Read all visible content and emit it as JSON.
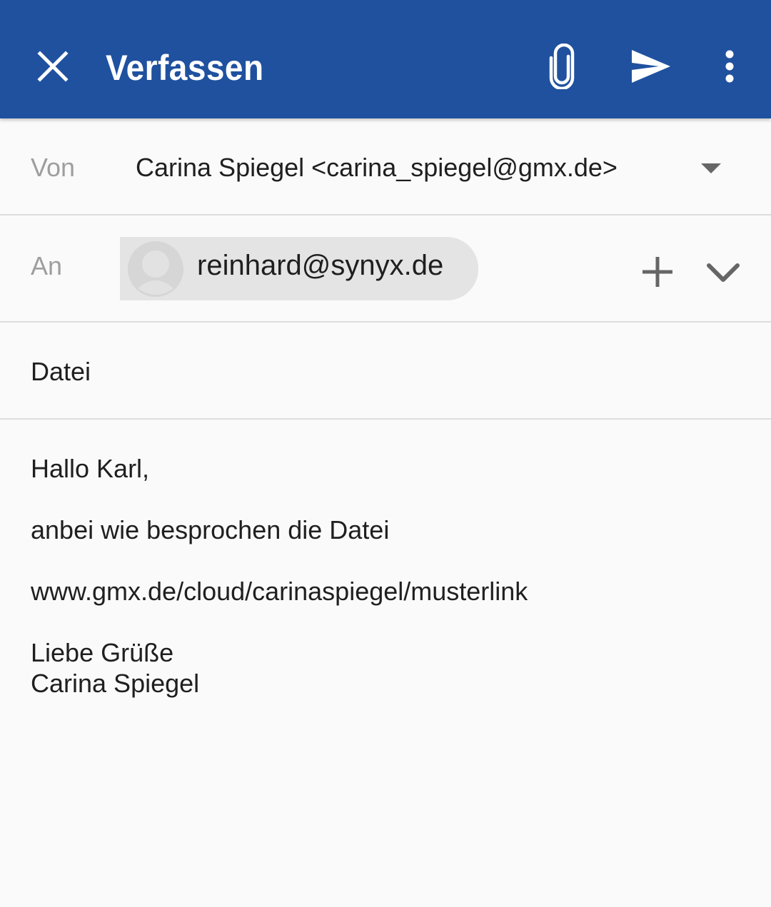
{
  "theme": {
    "appbar_color": "#1f519f",
    "background": "#fafafa",
    "chip_color": "#e4e4e4"
  },
  "appbar": {
    "title": "Verfassen",
    "icons": [
      "close-icon",
      "paperclip-icon",
      "send-icon",
      "more-vert-icon"
    ]
  },
  "from": {
    "label": "Von",
    "value": "Carina Spiegel <carina_spiegel@gmx.de>"
  },
  "to": {
    "label": "An",
    "recipients": [
      "reinhard@synyx.de"
    ]
  },
  "subject": {
    "value": "Datei"
  },
  "body": {
    "greeting": "Hallo Karl,",
    "line1": "anbei wie besprochen die Datei",
    "link": "www.gmx.de/cloud/carinaspiegel/musterlink",
    "closing": "Liebe Grüße",
    "signature": "Carina Spiegel"
  }
}
